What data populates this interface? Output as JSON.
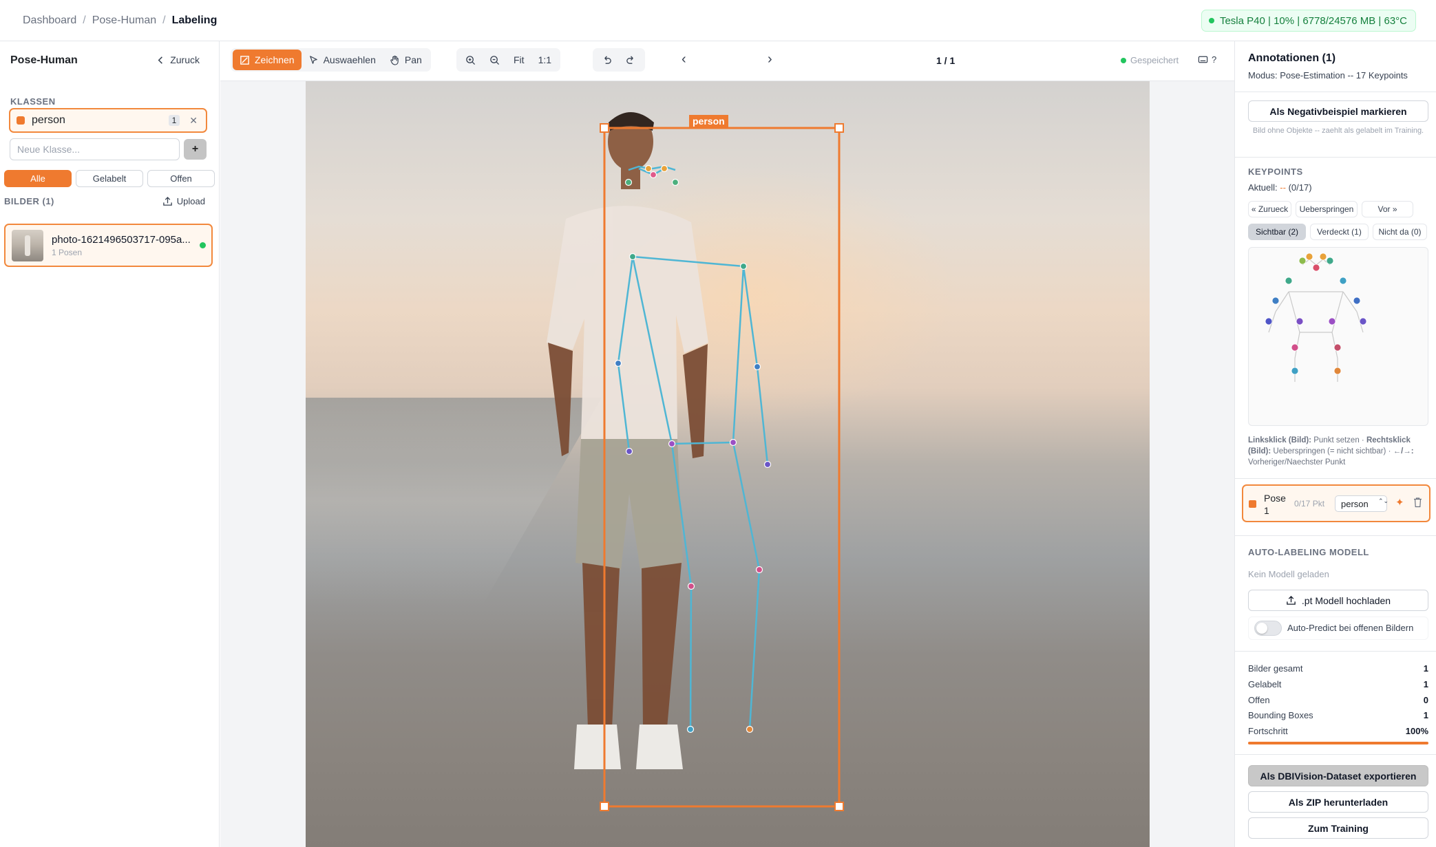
{
  "breadcrumb": {
    "items": [
      "Dashboard",
      "Pose-Human",
      "Labeling"
    ]
  },
  "gpu_status": "Tesla P40 | 10% | 6778/24576 MB | 63°C",
  "sidebar": {
    "project": "Pose-Human",
    "back_label": "Zuruck",
    "classes_heading": "KLASSEN",
    "classes": [
      {
        "name": "person",
        "count": "1",
        "color": "#ef7a2f"
      }
    ],
    "new_class_placeholder": "Neue Klasse...",
    "add_label": "+",
    "filters": [
      "Alle",
      "Gelabelt",
      "Offen"
    ],
    "images_heading": "BILDER (1)",
    "upload_label": "Upload",
    "images": [
      {
        "name": "photo-1621496503717-095a...",
        "sub": "1 Posen"
      }
    ]
  },
  "toolbar": {
    "draw": "Zeichnen",
    "select": "Auswaehlen",
    "pan": "Pan",
    "fit": "Fit",
    "one_to_one": "1:1",
    "page": "1 / 1",
    "saved": "Gespeichert",
    "help": "?"
  },
  "canvas": {
    "bbox_label": "person"
  },
  "right": {
    "title": "Annotationen (1)",
    "mode": "Modus: Pose-Estimation -- 17 Keypoints",
    "negative_btn": "Als Negativbeispiel markieren",
    "negative_note": "Bild ohne Objekte -- zaehlt als gelabelt im Training.",
    "keypoints_heading": "KEYPOINTS",
    "aktuell_prefix": "Aktuell:",
    "aktuell_value": "--",
    "aktuell_suffix": "(0/17)",
    "nav": [
      "« Zurueck",
      "Ueberspringen",
      "Vor »"
    ],
    "vis": [
      "Sichtbar (2)",
      "Verdeckt (1)",
      "Nicht da (0)"
    ],
    "help_click": "Linksklick (Bild):",
    "help_click_txt": "Punkt setzen ·",
    "help_right": "Rechtsklick (Bild):",
    "help_right_txt": "Ueberspringen (= nicht sichtbar) ·",
    "help_keys": "←/→:",
    "help_keys_txt": "Vorheriger/Naechster Punkt",
    "pose_name": "Pose 1",
    "pose_points": "0/17 Pkt",
    "pose_class": "person",
    "auto_heading": "AUTO-LABELING MODELL",
    "no_model": "Kein Modell geladen",
    "upload_model": ".pt Modell hochladen",
    "auto_predict": "Auto-Predict bei offenen Bildern",
    "stats": [
      {
        "label": "Bilder gesamt",
        "value": "1"
      },
      {
        "label": "Gelabelt",
        "value": "1"
      },
      {
        "label": "Offen",
        "value": "0"
      },
      {
        "label": "Bounding Boxes",
        "value": "1"
      },
      {
        "label": "Fortschritt",
        "value": "100%"
      }
    ],
    "progress": 1.0,
    "export_dbi": "Als DBIVision-Dataset exportieren",
    "export_zip": "Als ZIP herunterladen",
    "training": "Zum Training"
  },
  "colors": {
    "accent": "#ef7a2f",
    "skeleton": "#4fb6d4",
    "ok": "#22c55e"
  }
}
